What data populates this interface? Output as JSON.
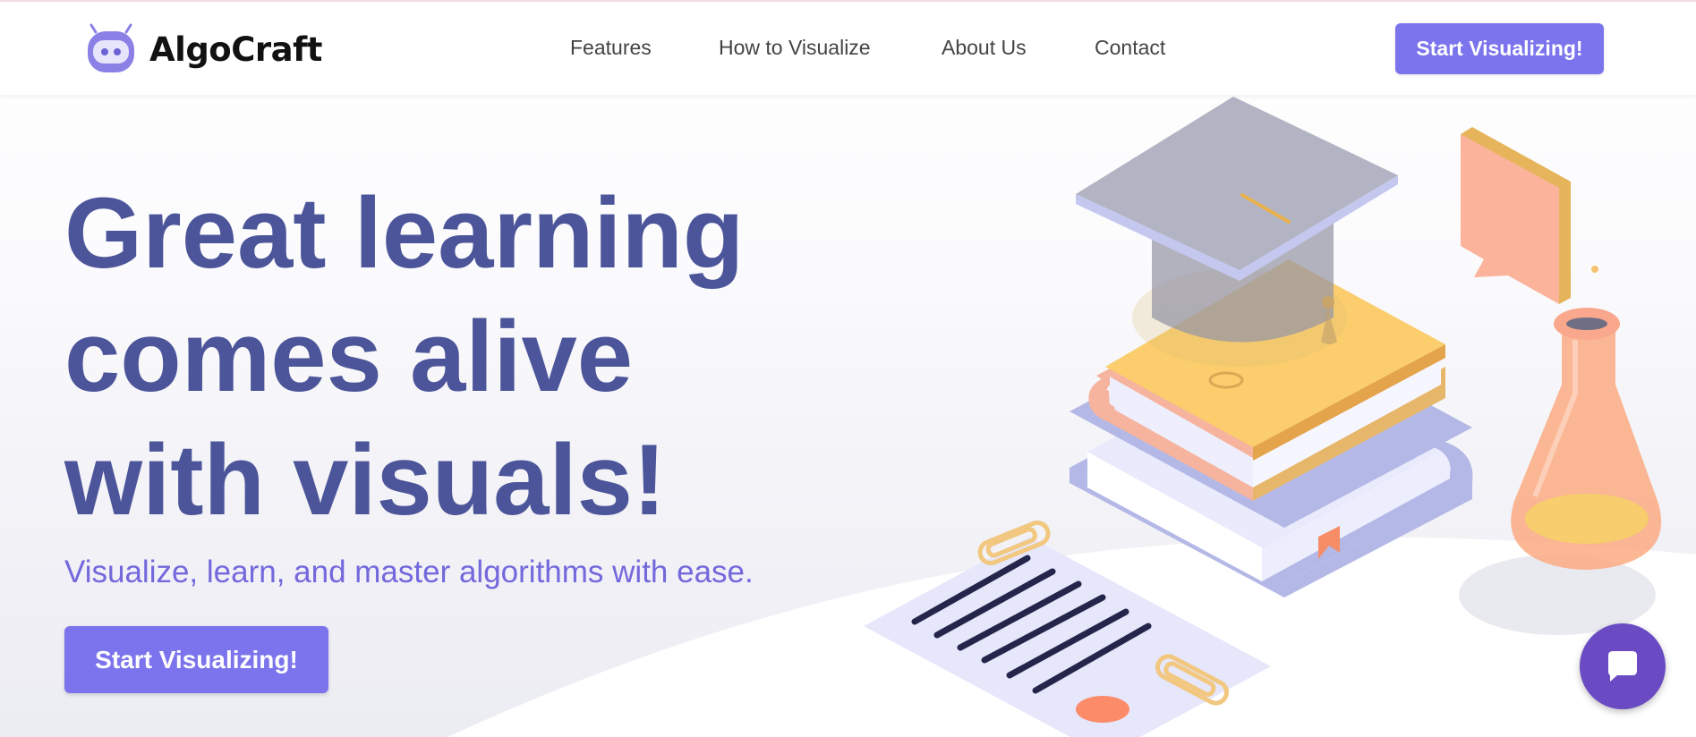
{
  "brand": {
    "name": "AlgoCraft",
    "logo_icon": "robot-head-icon"
  },
  "nav": {
    "links": [
      "Features",
      "How to Visualize",
      "About Us",
      "Contact"
    ],
    "cta_label": "Start Visualizing!"
  },
  "hero": {
    "title_lines": [
      "Great learning",
      "comes alive",
      "with visuals!"
    ],
    "subtitle": "Visualize, learn, and master algorithms with ease.",
    "cta_label": "Start Visualizing!"
  },
  "illustration": {
    "icons": [
      "graduation-cap-icon",
      "book-stack-icon",
      "speech-bubble-icon",
      "flask-icon",
      "document-icon",
      "paperclip-icon"
    ]
  },
  "chat": {
    "icon": "chat-bubble-icon"
  },
  "colors": {
    "accent": "#7b74ec",
    "title": "#4c5599",
    "subtitle": "#7368dc",
    "chat": "#6a4bc4"
  }
}
